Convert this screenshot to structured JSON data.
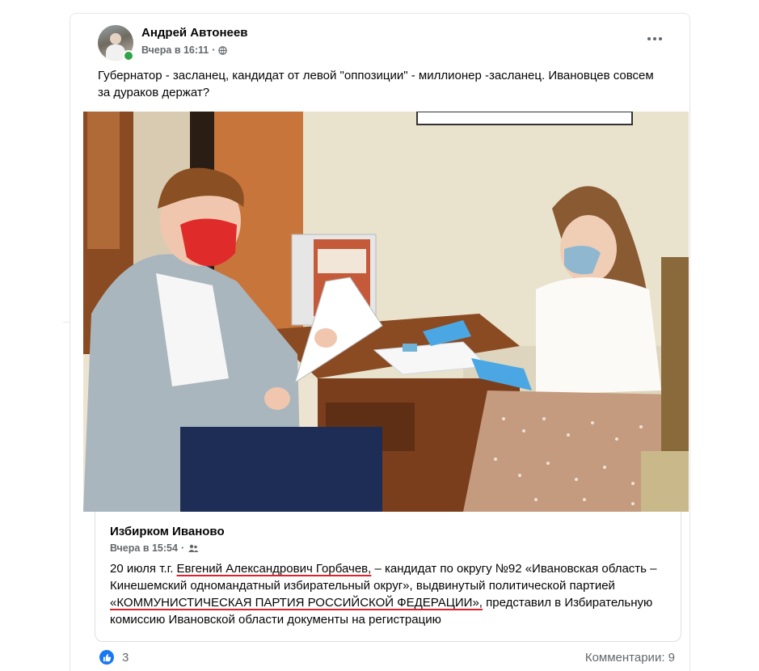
{
  "post": {
    "author": "Андрей Автонеев",
    "timestamp": "Вчера в 16:11",
    "privacy_icon": "globe-icon",
    "text": "Губернатор - засланец, кандидат от левой \"оппозиции\" - миллионер -засланец. Ивановцев совсем за дураков держат?"
  },
  "shared": {
    "author": "Избирком Иваново",
    "timestamp": "Вчера в 15:54",
    "privacy_icon": "friends-icon",
    "text_part1": "20 июля т.г. ",
    "text_name": "Евгений Александрович  Горбачев,",
    "text_part2": " – кандидат по округу №92 «Ивановская область – Кинешемский одномандатный избирательный округ», выдвинутый политической партией ",
    "text_party": "«КОММУНИСТИЧЕСКАЯ ПАРТИЯ РОССИЙСКОЙ ФЕДЕРАЦИИ»,",
    "text_part3": " представил в Избирательную комиссию Ивановской области документы на регистрацию"
  },
  "footer": {
    "reaction_icon": "like-icon",
    "like_count": "3",
    "comments_label": "Комментарии: 9"
  },
  "colors": {
    "accent": "#1877f2",
    "underline": "#e0202a",
    "online": "#31a24c",
    "secondary_text": "#65676b"
  }
}
